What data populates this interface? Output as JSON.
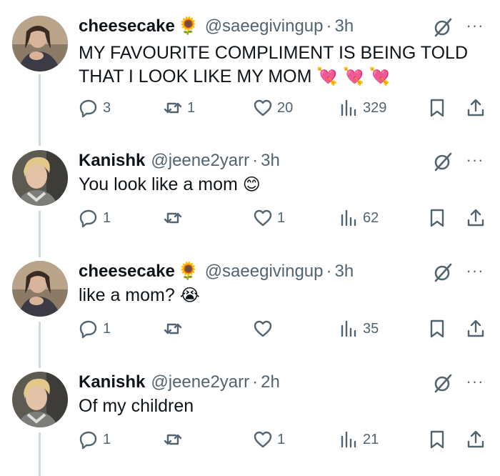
{
  "tweets": [
    {
      "name": "cheesecake",
      "badge_emoji": "🌻",
      "handle": "@saeegivingup",
      "time": "3h",
      "text": "MY FAVOURITE COMPLIMENT IS BEING TOLD THAT I LOOK LIKE MY MOM",
      "text_emoji": "💘 💘 💘",
      "replies": "3",
      "reposts": "1",
      "likes": "20",
      "views": "329",
      "avatar": "cheesecake-avatar"
    },
    {
      "name": "Kanishk",
      "badge_emoji": "",
      "handle": "@jeene2yarr",
      "time": "3h",
      "text": "You look like a mom",
      "text_emoji": "😊",
      "replies": "1",
      "reposts": "",
      "likes": "1",
      "views": "62",
      "avatar": "kanishk-avatar"
    },
    {
      "name": "cheesecake",
      "badge_emoji": "🌻",
      "handle": "@saeegivingup",
      "time": "3h",
      "text": "like a mom?",
      "text_emoji": "😭",
      "replies": "1",
      "reposts": "",
      "likes": "",
      "views": "35",
      "avatar": "cheesecake-avatar"
    },
    {
      "name": "Kanishk",
      "badge_emoji": "",
      "handle": "@jeene2yarr",
      "time": "2h",
      "text": "Of my children",
      "text_emoji": "",
      "replies": "1",
      "reposts": "",
      "likes": "1",
      "views": "21",
      "avatar": "kanishk-avatar"
    }
  ],
  "separator": "·",
  "more_label": "···",
  "colors": {
    "text": "#0f1419",
    "secondary": "#536471",
    "thread_line": "#cfd9de"
  }
}
